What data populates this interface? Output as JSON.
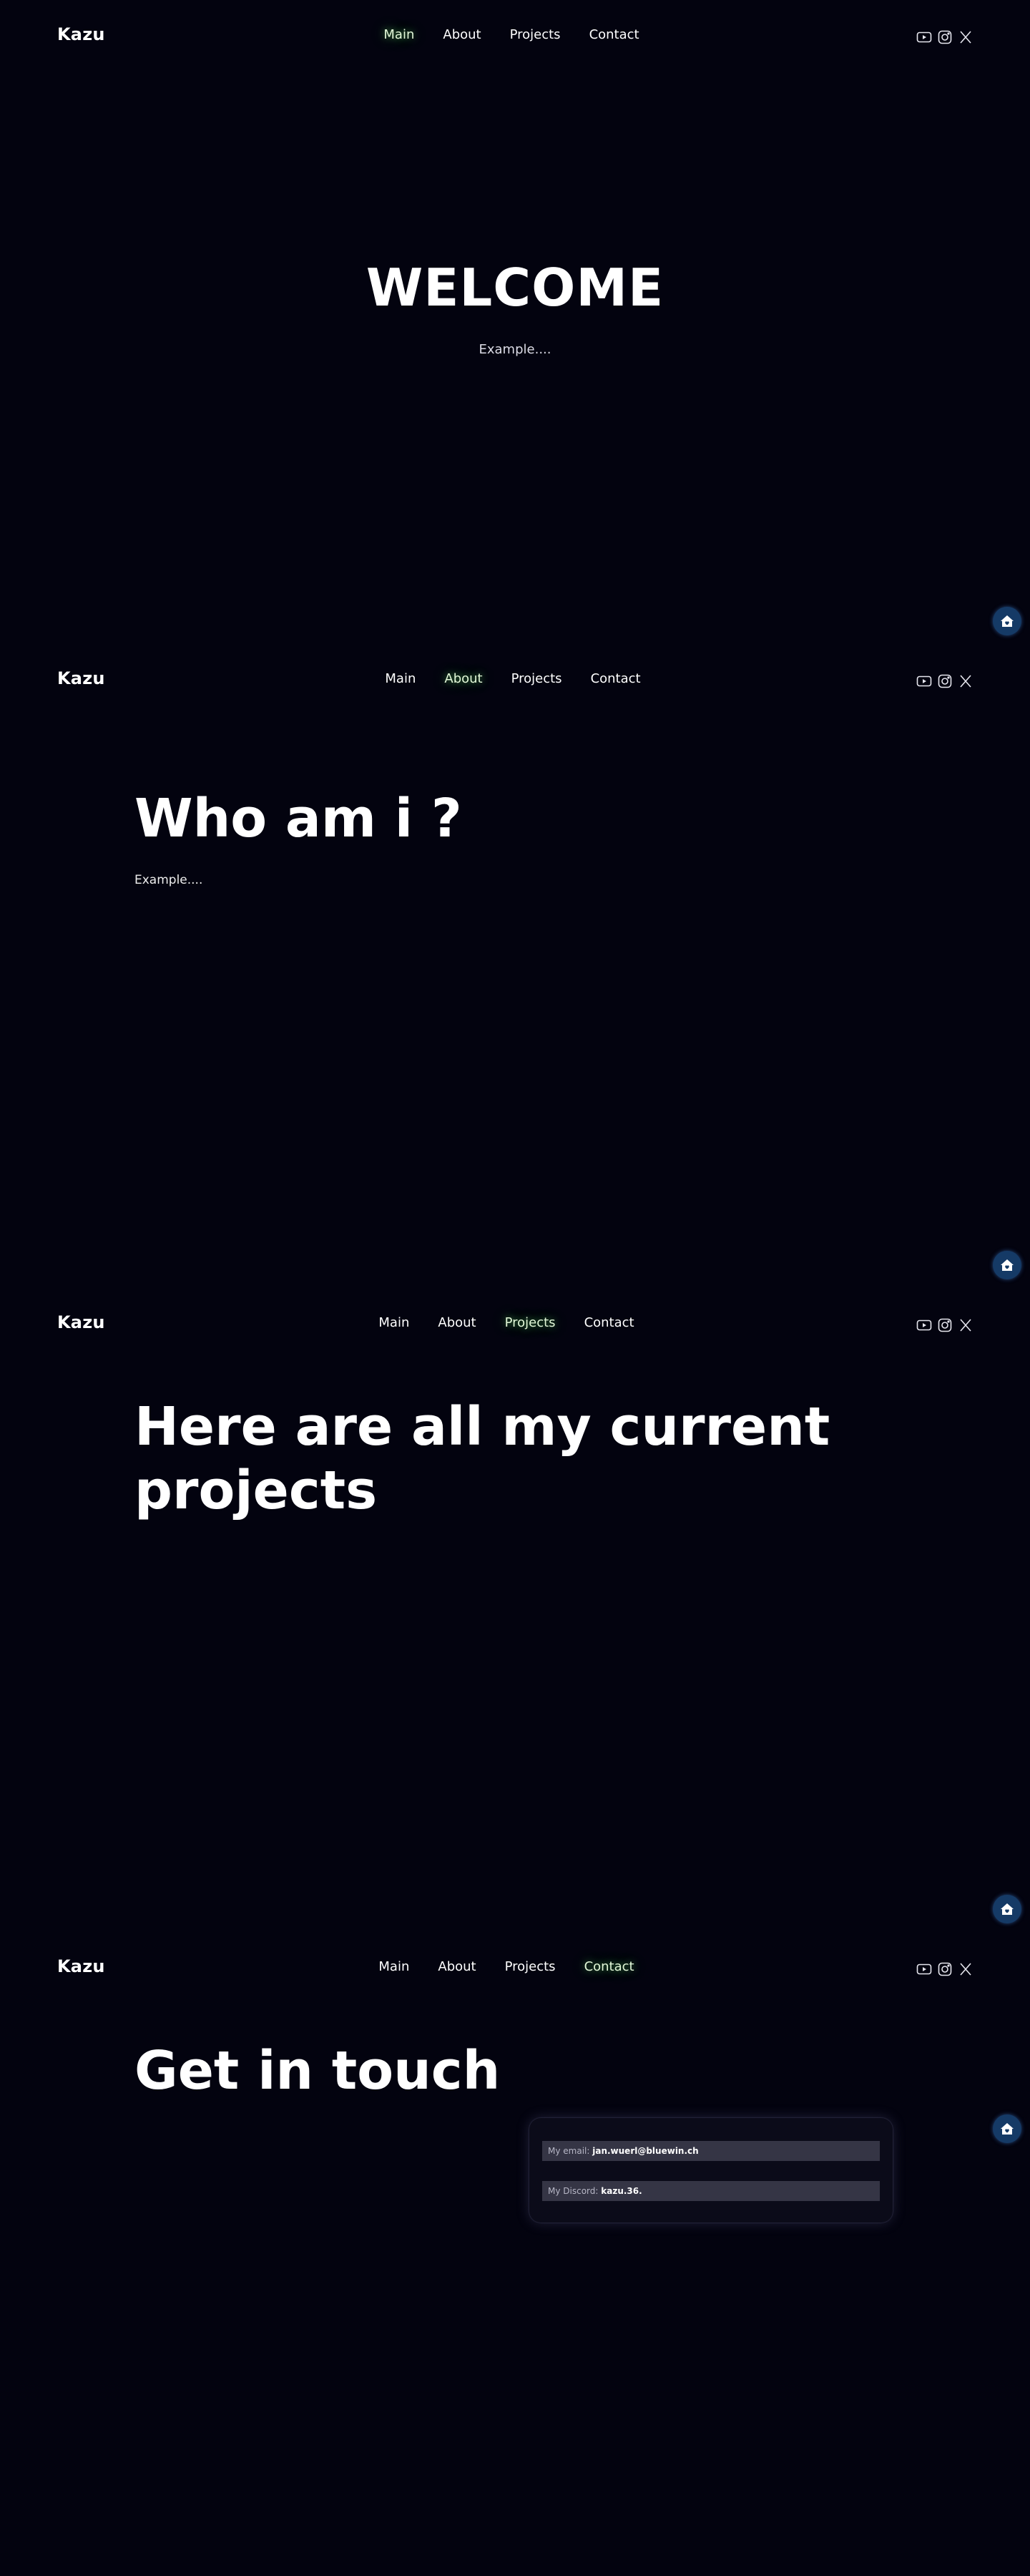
{
  "brand": "Kazu",
  "nav": [
    "Main",
    "About",
    "Projects",
    "Contact"
  ],
  "socials": [
    "youtube-icon",
    "instagram-icon",
    "x-icon"
  ],
  "hero": {
    "title": "WELCOME",
    "subtitle": "Example...."
  },
  "about": {
    "title": "Who am i ?",
    "subtitle": "Example...."
  },
  "projects": {
    "title_line1": "Here are all my current",
    "title_line2": "projects"
  },
  "contact": {
    "title": "Get in touch",
    "email_label": "My email:",
    "email_value": "jan.wuerl@bluewin.ch",
    "discord_label": "My Discord:",
    "discord_value": "kazu.36."
  },
  "colors": {
    "background": "#03030f",
    "active_nav": "#e2f7d8",
    "home_button": "#153a66",
    "contact_row": "#353545"
  }
}
